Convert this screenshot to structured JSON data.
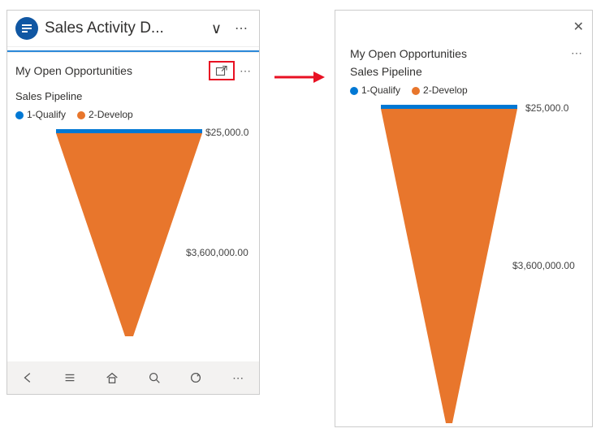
{
  "left": {
    "app_title": "Sales Activity D...",
    "section_title": "My Open Opportunities",
    "chart_title": "Sales Pipeline",
    "legend": {
      "s1": "1-Qualify",
      "s2": "2-Develop"
    },
    "labels": {
      "top": "$25,000.0",
      "mid": "$3,600,000.00"
    }
  },
  "right": {
    "section_title": "My Open Opportunities",
    "chart_title": "Sales Pipeline",
    "legend": {
      "s1": "1-Qualify",
      "s2": "2-Develop"
    },
    "labels": {
      "top": "$25,000.0",
      "mid": "$3,600,000.00"
    }
  },
  "colors": {
    "qualify": "#0078d4",
    "develop": "#e8762c"
  },
  "chart_data": {
    "type": "funnel",
    "categories": [
      "1-Qualify",
      "2-Develop"
    ],
    "values": [
      25000.0,
      3600000.0
    ],
    "title": "Sales Pipeline",
    "display_labels": [
      "$25,000.0",
      "$3,600,000.00"
    ]
  }
}
